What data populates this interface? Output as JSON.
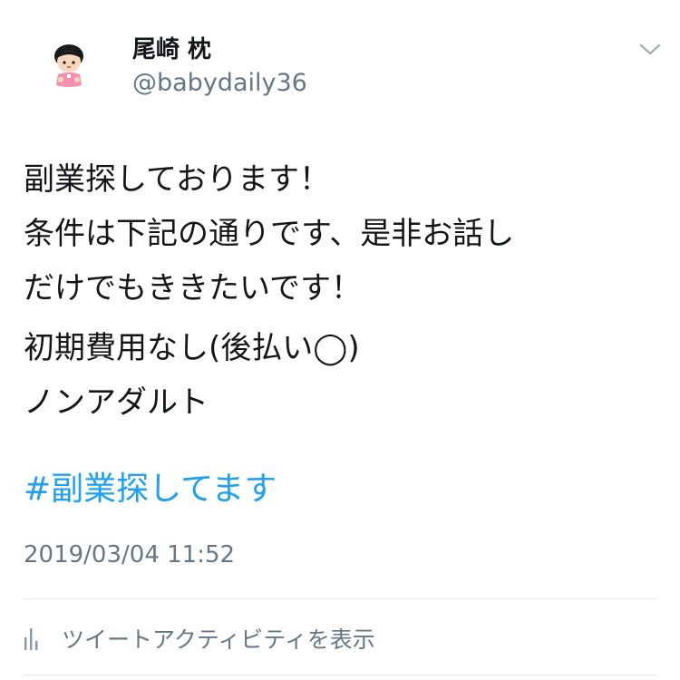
{
  "tweet": {
    "author": {
      "display_name": "尾崎 枕",
      "handle": "@babydaily36",
      "avatar_icon": "avatar-baby-icon"
    },
    "text": {
      "lines": [
        "副業探しております！",
        "条件は下記の通りです、是非お話し",
        "だけでもききたいです！"
      ],
      "conditions": [
        "初期費用なし(後払い◯)",
        "ノンアダルト"
      ]
    },
    "hashtag": "#副業探してます",
    "timestamp": "2019/03/04 11:52",
    "activity_label": "ツイートアクティビティを表示"
  },
  "icons": {
    "more": "chevron-down-icon",
    "activity": "bar-chart-icon"
  },
  "colors": {
    "link": "#1da1f2",
    "secondary_text": "#657786",
    "primary_text": "#14171a",
    "divider": "#e1e8ed"
  }
}
